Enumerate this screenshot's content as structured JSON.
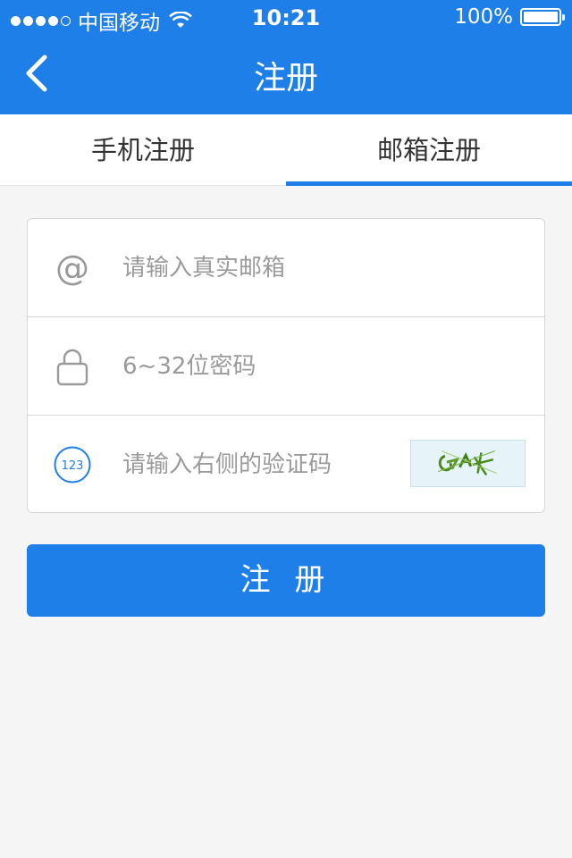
{
  "status_bar": {
    "carrier": "中国移动",
    "time": "10:21",
    "battery": "100%",
    "signal_bars_filled": 4,
    "signal_bars_total": 5
  },
  "header": {
    "title": "注册",
    "back_icon": "chevron-left-icon",
    "color": "#1f7fe8"
  },
  "tabs": [
    {
      "label": "手机注册",
      "active": false
    },
    {
      "label": "邮箱注册",
      "active": true
    }
  ],
  "form": {
    "email": {
      "placeholder": "请输入真实邮箱",
      "icon": "at-icon",
      "value": ""
    },
    "password": {
      "placeholder": "6~32位密码",
      "icon": "lock-icon",
      "value": ""
    },
    "captcha": {
      "placeholder": "请输入右侧的验证码",
      "icon": "number-123-icon",
      "icon_text": "123",
      "value": ""
    }
  },
  "submit_label": "注 册"
}
